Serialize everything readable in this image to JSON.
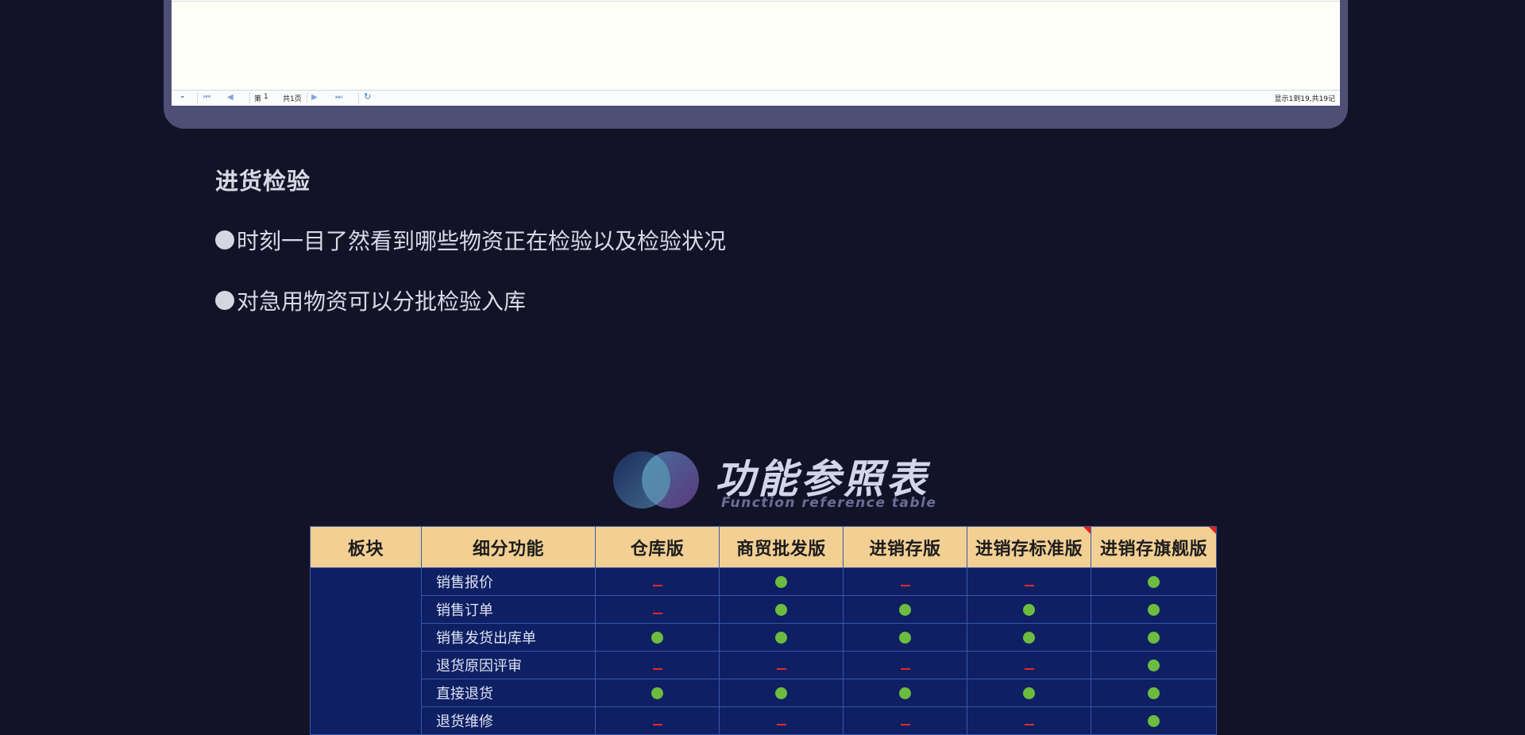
{
  "pager": {
    "page_label": "第",
    "page_value": "1",
    "total_label": "共1页",
    "status": "显示1到19,共19记"
  },
  "section": {
    "title": "进货检验",
    "bullets": [
      "时刻一目了然看到哪些物资正在检验以及检验状况",
      "对急用物资可以分批检验入库"
    ]
  },
  "logo": {
    "title": "功能参照表",
    "subtitle": "Function reference table"
  },
  "table": {
    "headers": [
      "板块",
      "细分功能",
      "仓库版",
      "商贸批发版",
      "进销存版",
      "进销存标准版",
      "进销存旗舰版"
    ],
    "rows": [
      {
        "name": "销售报价",
        "marks": [
          "no",
          "yes",
          "no",
          "no",
          "yes"
        ]
      },
      {
        "name": "销售订单",
        "marks": [
          "no",
          "yes",
          "yes",
          "yes",
          "yes"
        ]
      },
      {
        "name": "销售发货出库单",
        "marks": [
          "yes",
          "yes",
          "yes",
          "yes",
          "yes"
        ]
      },
      {
        "name": "退货原因评审",
        "marks": [
          "no",
          "no",
          "no",
          "no",
          "yes"
        ]
      },
      {
        "name": "直接退货",
        "marks": [
          "yes",
          "yes",
          "yes",
          "yes",
          "yes"
        ]
      },
      {
        "name": "退货维修",
        "marks": [
          "no",
          "no",
          "no",
          "no",
          "yes"
        ]
      }
    ]
  },
  "colors": {
    "background": "#131328",
    "header_bg": "#f2cf93",
    "cell_bg": "#0e1f63",
    "yes_mark": "#6cbc3f",
    "no_mark": "#e32a2a"
  }
}
